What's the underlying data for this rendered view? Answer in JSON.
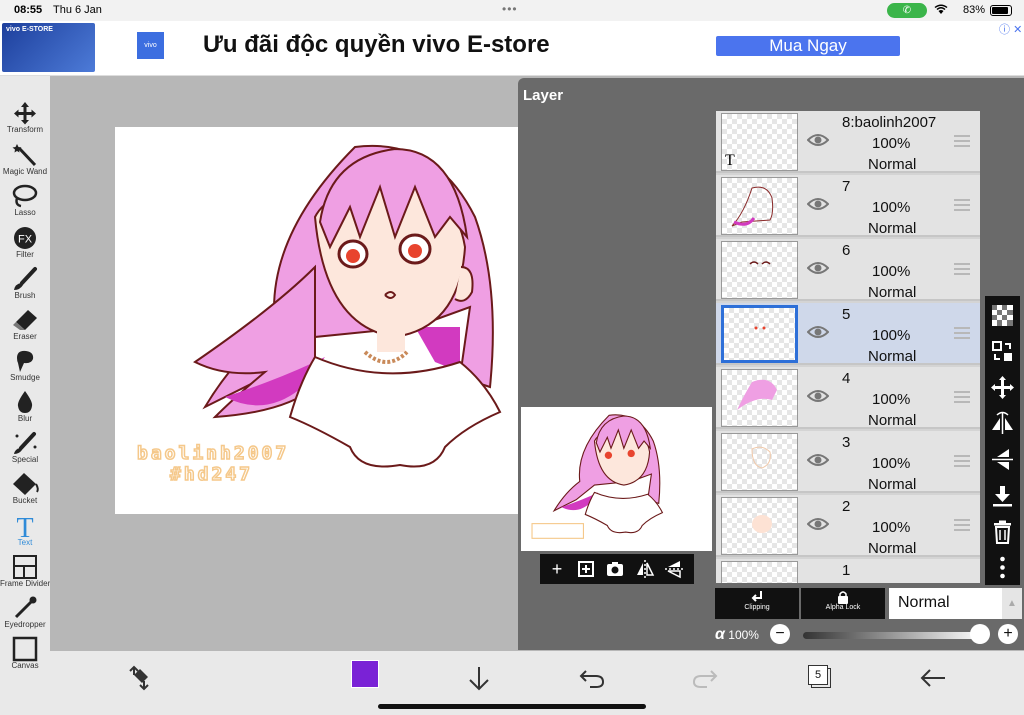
{
  "status_bar": {
    "time": "08:55",
    "date": "Thu 6 Jan",
    "battery": "83%",
    "battery_level": 0.83
  },
  "ad": {
    "thumb_text": "vivo E-STORE",
    "logo": "vivo",
    "title": "Ưu đãi độc quyền vivo E-store",
    "cta": "Mua Ngay",
    "info_icon": "ⓘ",
    "close": "✕"
  },
  "toolbar": {
    "tools": [
      {
        "id": "transform",
        "label": "Transform",
        "icon": "move-icon"
      },
      {
        "id": "magic-wand",
        "label": "Magic Wand",
        "icon": "magic-wand-icon"
      },
      {
        "id": "lasso",
        "label": "Lasso",
        "icon": "lasso-icon"
      },
      {
        "id": "filter",
        "label": "Filter",
        "icon": "fx-icon"
      },
      {
        "id": "brush",
        "label": "Brush",
        "icon": "brush-icon"
      },
      {
        "id": "eraser",
        "label": "Eraser",
        "icon": "eraser-icon"
      },
      {
        "id": "smudge",
        "label": "Smudge",
        "icon": "smudge-icon"
      },
      {
        "id": "blur",
        "label": "Blur",
        "icon": "drop-icon"
      },
      {
        "id": "special",
        "label": "Special",
        "icon": "special-brush-icon"
      },
      {
        "id": "bucket",
        "label": "Bucket",
        "icon": "bucket-icon"
      },
      {
        "id": "text",
        "label": "Text",
        "icon": "text-icon",
        "active": true
      },
      {
        "id": "frame-divider",
        "label": "Frame Divider",
        "icon": "frame-divider-icon"
      },
      {
        "id": "eyedropper",
        "label": "Eyedropper",
        "icon": "eyedropper-icon"
      },
      {
        "id": "canvas",
        "label": "Canvas",
        "icon": "canvas-icon"
      }
    ]
  },
  "canvas": {
    "watermark_line1": "baolinh2007",
    "watermark_line2": "#hd247"
  },
  "layer_panel": {
    "title": "Layer",
    "layers": [
      {
        "name": "8:baolinh2007",
        "opacity": "100%",
        "blend": "Normal",
        "type_badge": "T",
        "selected": false
      },
      {
        "name": "7",
        "opacity": "100%",
        "blend": "Normal",
        "selected": false
      },
      {
        "name": "6",
        "opacity": "100%",
        "blend": "Normal",
        "selected": false
      },
      {
        "name": "5",
        "opacity": "100%",
        "blend": "Normal",
        "selected": true
      },
      {
        "name": "4",
        "opacity": "100%",
        "blend": "Normal",
        "selected": false
      },
      {
        "name": "3",
        "opacity": "100%",
        "blend": "Normal",
        "selected": false
      },
      {
        "name": "2",
        "opacity": "100%",
        "blend": "Normal",
        "selected": false
      },
      {
        "name": "1",
        "opacity": "",
        "blend": "",
        "selected": false
      }
    ],
    "clipping_label": "Clipping",
    "alpha_lock_label": "Alpha Lock",
    "blend_mode": "Normal",
    "alpha_symbol": "α",
    "alpha_value": "100%",
    "alpha_fraction": 1.0
  },
  "bottom_bar": {
    "color_swatch": "#7a22d6",
    "layer_count": "5"
  },
  "colors": {
    "accent_blue": "#2f8bd8",
    "selected_layer": "#cfd8ea",
    "hair_pink": "#ef9fe3",
    "hair_magenta": "#d23ac0",
    "watermark": "#f5c88a"
  }
}
